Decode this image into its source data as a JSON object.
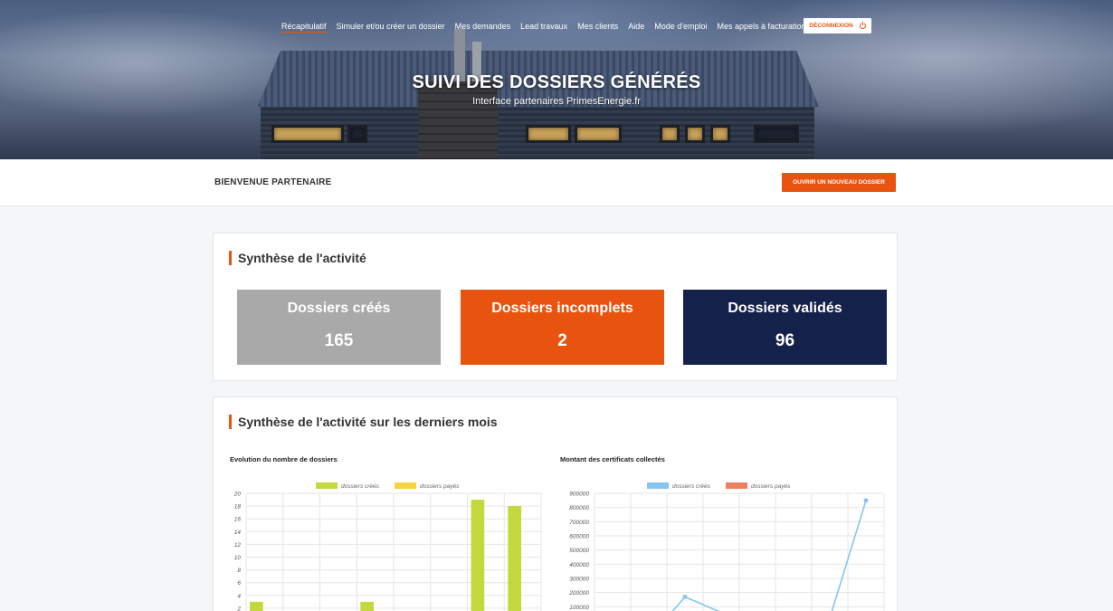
{
  "nav": {
    "items": [
      {
        "label": "Récapitulatif",
        "active": true
      },
      {
        "label": "Simuler et/ou créer un dossier"
      },
      {
        "label": "Mes demandes"
      },
      {
        "label": "Lead travaux"
      },
      {
        "label": "Mes clients"
      },
      {
        "label": "Aide"
      },
      {
        "label": "Mode d'emploi"
      },
      {
        "label": "Mes appels à facturations"
      }
    ],
    "logout_label": "DÉCONNEXION"
  },
  "hero": {
    "title": "SUIVI DES DOSSIERS GÉNÉRÉS",
    "subtitle": "Interface partenaires PrimesEnergie.fr"
  },
  "welcome": {
    "label": "BIENVENUE PARTENAIRE",
    "new_file_button": "OUVRIR UN NOUVEAU DOSSIER"
  },
  "summary": {
    "title": "Synthèse de l'activité",
    "stats": [
      {
        "label": "Dossiers créés",
        "value": "165",
        "color": "#a9a9a9"
      },
      {
        "label": "Dossiers incomplets",
        "value": "2",
        "color": "#e8540f"
      },
      {
        "label": "Dossiers validés",
        "value": "96",
        "color": "#14214a"
      }
    ]
  },
  "monthly": {
    "title": "Synthèse de l'activité sur les derniers mois"
  },
  "colors": {
    "accent": "#e8540f",
    "navy": "#14214a",
    "bar_created": "#c3d83c",
    "bar_paid": "#f5d442",
    "line_created": "#85c5f0",
    "line_paid": "#ee8060"
  },
  "chart_data": [
    {
      "type": "bar",
      "title": "Evolution du nombre de dossiers",
      "legend": [
        "dossiers créés",
        "dossiers payés"
      ],
      "y_ticks": [
        "20",
        "18",
        "16",
        "14",
        "12",
        "10",
        "8",
        "6",
        "4",
        "2"
      ],
      "ylim": [
        0,
        20
      ],
      "series": [
        {
          "name": "dossiers créés",
          "values": [
            3,
            0,
            0,
            3,
            0,
            0,
            19,
            18
          ]
        },
        {
          "name": "dossiers payés",
          "values": [
            0,
            0,
            0,
            0,
            0,
            0,
            0,
            0
          ]
        }
      ],
      "legend_position": "top-center",
      "grid": true
    },
    {
      "type": "line",
      "title": "Montant des certificats collectés",
      "legend": [
        "dossiers créés",
        "dossiers payés"
      ],
      "y_ticks": [
        "900000",
        "800000",
        "700000",
        "600000",
        "500000",
        "400000",
        "300000",
        "200000",
        "100000"
      ],
      "ylim": [
        0,
        900000
      ],
      "series": [
        {
          "name": "dossiers créés",
          "values": [
            0,
            0,
            170000,
            60000,
            0,
            0,
            20000,
            850000
          ]
        }
      ],
      "legend_position": "top-center",
      "grid": true
    }
  ]
}
